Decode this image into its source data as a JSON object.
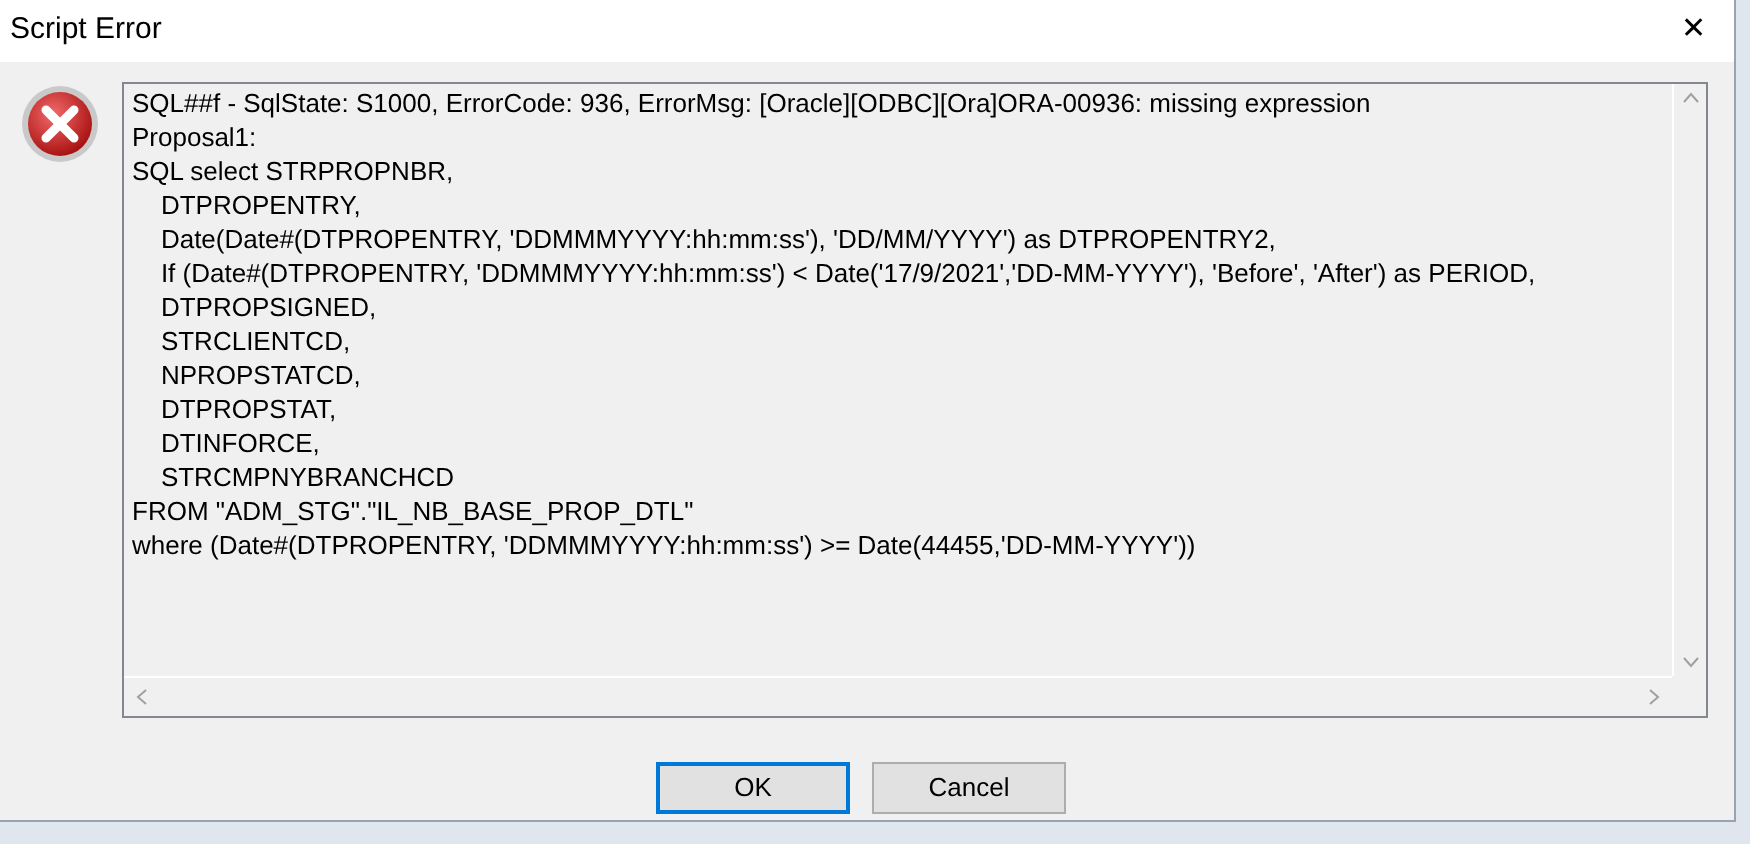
{
  "window": {
    "title": "Script Error",
    "close": "✕"
  },
  "message_lines": [
    "SQL##f - SqlState: S1000, ErrorCode: 936, ErrorMsg: [Oracle][ODBC][Ora]ORA-00936: missing expression",
    "Proposal1:",
    "SQL select STRPROPNBR,",
    "    DTPROPENTRY,",
    "    Date(Date#(DTPROPENTRY, 'DDMMMYYYY:hh:mm:ss'), 'DD/MM/YYYY') as DTPROPENTRY2,",
    "    If (Date#(DTPROPENTRY, 'DDMMMYYYY:hh:mm:ss') < Date('17/9/2021','DD-MM-YYYY'), 'Before', 'After') as PERIOD,",
    "    DTPROPSIGNED,",
    "    STRCLIENTCD,",
    "    NPROPSTATCD,",
    "    DTPROPSTAT,",
    "    DTINFORCE,",
    "    STRCMPNYBRANCHCD",
    "FROM \"ADM_STG\".\"IL_NB_BASE_PROP_DTL\"",
    "where (Date#(DTPROPENTRY, 'DDMMMYYYY:hh:mm:ss') >= Date(44455,'DD-MM-YYYY'))"
  ],
  "buttons": [
    {
      "label": "OK",
      "selected": true
    },
    {
      "label": "Cancel",
      "selected": false
    }
  ]
}
